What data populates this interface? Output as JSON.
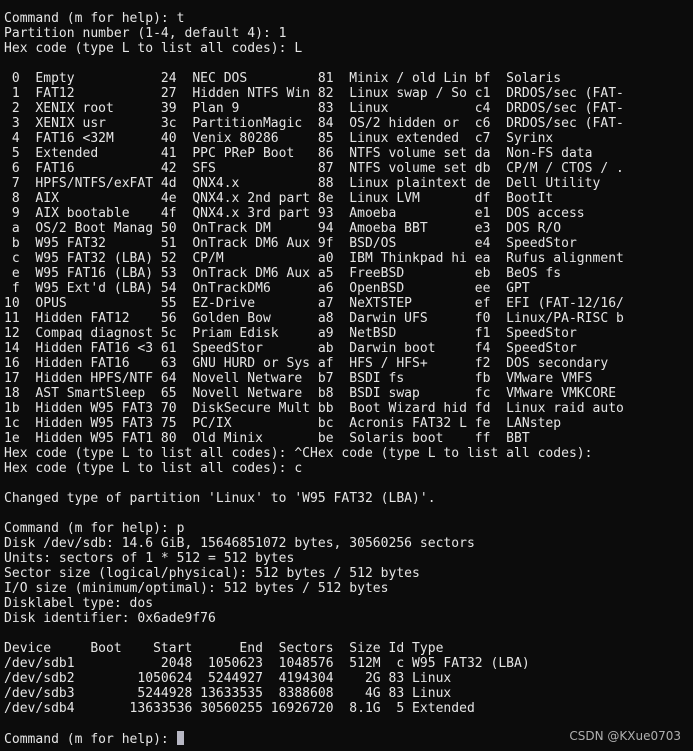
{
  "terminal": {
    "lines": [
      "Command (m for help): t",
      "Partition number (1-4, default 4): 1",
      "Hex code (type L to list all codes): L",
      "",
      " 0  Empty           24  NEC DOS         81  Minix / old Lin bf  Solaris",
      " 1  FAT12           27  Hidden NTFS Win 82  Linux swap / So c1  DRDOS/sec (FAT-",
      " 2  XENIX root      39  Plan 9          83  Linux           c4  DRDOS/sec (FAT-",
      " 3  XENIX usr       3c  PartitionMagic  84  OS/2 hidden or  c6  DRDOS/sec (FAT-",
      " 4  FAT16 <32M      40  Venix 80286     85  Linux extended  c7  Syrinx",
      " 5  Extended        41  PPC PReP Boot   86  NTFS volume set da  Non-FS data",
      " 6  FAT16           42  SFS             87  NTFS volume set db  CP/M / CTOS / .",
      " 7  HPFS/NTFS/exFAT 4d  QNX4.x          88  Linux plaintext de  Dell Utility",
      " 8  AIX             4e  QNX4.x 2nd part 8e  Linux LVM       df  BootIt",
      " 9  AIX bootable    4f  QNX4.x 3rd part 93  Amoeba          e1  DOS access",
      " a  OS/2 Boot Manag 50  OnTrack DM      94  Amoeba BBT      e3  DOS R/O",
      " b  W95 FAT32       51  OnTrack DM6 Aux 9f  BSD/OS          e4  SpeedStor",
      " c  W95 FAT32 (LBA) 52  CP/M            a0  IBM Thinkpad hi ea  Rufus alignment",
      " e  W95 FAT16 (LBA) 53  OnTrack DM6 Aux a5  FreeBSD         eb  BeOS fs",
      " f  W95 Ext'd (LBA) 54  OnTrackDM6      a6  OpenBSD         ee  GPT",
      "10  OPUS            55  EZ-Drive        a7  NeXTSTEP        ef  EFI (FAT-12/16/",
      "11  Hidden FAT12    56  Golden Bow      a8  Darwin UFS      f0  Linux/PA-RISC b",
      "12  Compaq diagnost 5c  Priam Edisk     a9  NetBSD          f1  SpeedStor",
      "14  Hidden FAT16 <3 61  SpeedStor       ab  Darwin boot     f4  SpeedStor",
      "16  Hidden FAT16    63  GNU HURD or Sys af  HFS / HFS+      f2  DOS secondary",
      "17  Hidden HPFS/NTF 64  Novell Netware  b7  BSDI fs         fb  VMware VMFS",
      "18  AST SmartSleep  65  Novell Netware  b8  BSDI swap       fc  VMware VMKCORE",
      "1b  Hidden W95 FAT3 70  DiskSecure Mult bb  Boot Wizard hid fd  Linux raid auto",
      "1c  Hidden W95 FAT3 75  PC/IX           bc  Acronis FAT32 L fe  LANstep",
      "1e  Hidden W95 FAT1 80  Old Minix       be  Solaris boot    ff  BBT",
      "Hex code (type L to list all codes): ^CHex code (type L to list all codes):",
      "Hex code (type L to list all codes): c",
      "",
      "Changed type of partition 'Linux' to 'W95 FAT32 (LBA)'.",
      "",
      "Command (m for help): p",
      "Disk /dev/sdb: 14.6 GiB, 15646851072 bytes, 30560256 sectors",
      "Units: sectors of 1 * 512 = 512 bytes",
      "Sector size (logical/physical): 512 bytes / 512 bytes",
      "I/O size (minimum/optimal): 512 bytes / 512 bytes",
      "Disklabel type: dos",
      "Disk identifier: 0x6ade9f76",
      "",
      "Device     Boot    Start      End  Sectors  Size Id Type",
      "/dev/sdb1           2048  1050623  1048576  512M  c W95 FAT32 (LBA)",
      "/dev/sdb2        1050624  5244927  4194304    2G 83 Linux",
      "/dev/sdb3        5244928 13633535  8388608    4G 83 Linux",
      "/dev/sdb4       13633536 30560255 16926720  8.1G  5 Extended",
      ""
    ],
    "prompt": "Command (m for help): ",
    "cursor_icon": "block-cursor"
  },
  "watermark": "CSDN @KXue0703"
}
